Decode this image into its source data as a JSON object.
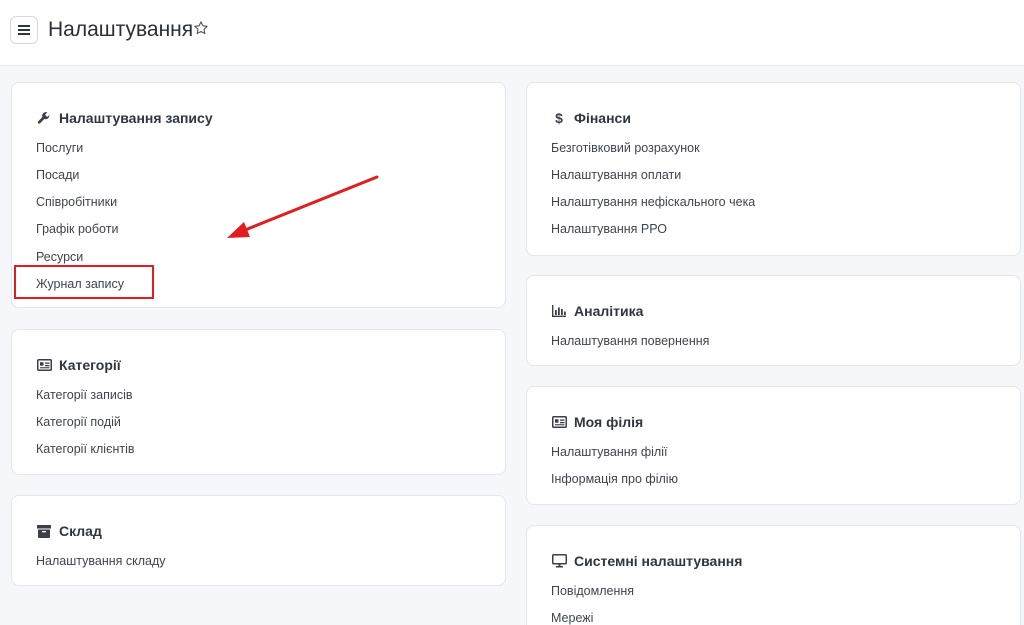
{
  "header": {
    "title": "Налаштування",
    "menu_icon": "hamburger-menu-icon",
    "favorite_icon": "star-outline-icon"
  },
  "cards": {
    "booking": {
      "title": "Налаштування запису",
      "icon": "wrench-icon",
      "items": [
        "Послуги",
        "Посади",
        "Співробітники",
        "Графік роботи",
        "Ресурси",
        "Журнал запису"
      ]
    },
    "categories": {
      "title": "Категорії",
      "icon": "id-card-icon",
      "items": [
        "Категорії записів",
        "Категорії подій",
        "Категорії клієнтів"
      ]
    },
    "warehouse": {
      "title": "Склад",
      "icon": "archive-box-icon",
      "items": [
        "Налаштування складу"
      ]
    },
    "finance": {
      "title": "Фінанси",
      "icon": "dollar-icon",
      "items": [
        "Безготівковий розрахунок",
        "Налаштування оплати",
        "Налаштування нефіскального чека",
        "Налаштування РРО"
      ]
    },
    "analytics": {
      "title": "Аналітика",
      "icon": "bar-chart-icon",
      "items": [
        "Налаштування повернення"
      ]
    },
    "branch": {
      "title": "Моя філія",
      "icon": "id-card-icon",
      "items": [
        "Налаштування філії",
        "Інформація про філію"
      ]
    },
    "system": {
      "title": "Системні налаштування",
      "icon": "monitor-icon",
      "items": [
        "Повідомлення",
        "Мережі"
      ]
    }
  },
  "annotation": {
    "highlight_color": "#e11d1d",
    "highlighted_item": "Журнал запису"
  }
}
